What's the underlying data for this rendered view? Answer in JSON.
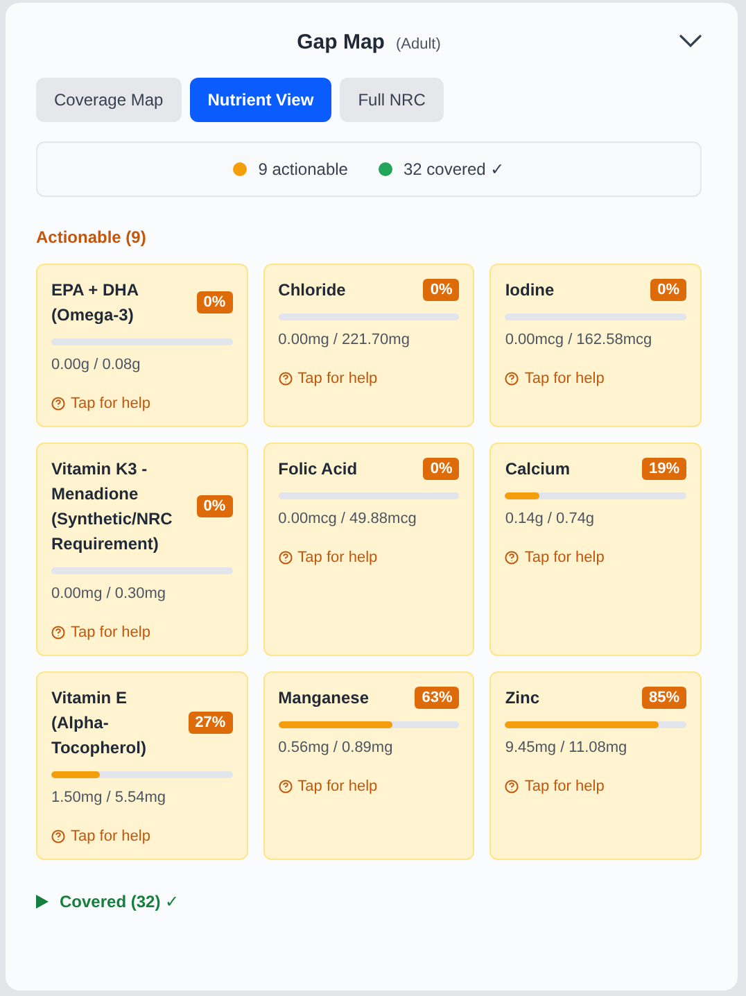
{
  "header": {
    "title": "Gap Map",
    "subtitle": "(Adult)",
    "expanded": true
  },
  "tabs": [
    {
      "label": "Coverage Map",
      "selected": false
    },
    {
      "label": "Nutrient View",
      "selected": true
    },
    {
      "label": "Full NRC",
      "selected": false
    }
  ],
  "summary": [
    {
      "label": "9 actionable",
      "color": "#f59e0b"
    },
    {
      "label": "32 covered ✓",
      "color": "#22a55b"
    }
  ],
  "actionable": {
    "heading": "Actionable (9)",
    "items": [
      {
        "name": "EPA + DHA (Omega-3)",
        "percent": "0%",
        "amount": "0.00g / 0.08g",
        "help": "Tap for help"
      },
      {
        "name": "Chloride",
        "percent": "0%",
        "amount": "0.00mg / 221.70mg",
        "help": "Tap for help"
      },
      {
        "name": "Iodine",
        "percent": "0%",
        "amount": "0.00mcg / 162.58mcg",
        "help": "Tap for help"
      },
      {
        "name": "Vitamin K3 - Menadione (Synthetic/NRC Requirement)",
        "percent": "0%",
        "amount": "0.00mg / 0.30mg",
        "help": "Tap for help"
      },
      {
        "name": "Folic Acid",
        "percent": "0%",
        "amount": "0.00mcg / 49.88mcg",
        "help": "Tap for help"
      },
      {
        "name": "Calcium",
        "percent": "19%",
        "level": 0.19,
        "amount": "0.14g / 0.74g",
        "help": "Tap for help"
      },
      {
        "name": "Vitamin E (Alpha-Tocopherol)",
        "percent": "27%",
        "level": 0.27,
        "amount": "1.50mg / 5.54mg",
        "help": "Tap for help"
      },
      {
        "name": "Manganese",
        "percent": "63%",
        "level": 0.63,
        "amount": "0.56mg / 0.89mg",
        "help": "Tap for help"
      },
      {
        "name": "Zinc",
        "percent": "85%",
        "level": 0.85,
        "amount": "9.45mg / 11.08mg",
        "help": "Tap for help"
      }
    ]
  },
  "covered": {
    "label": "Covered (32) ✓",
    "expanded": false
  }
}
